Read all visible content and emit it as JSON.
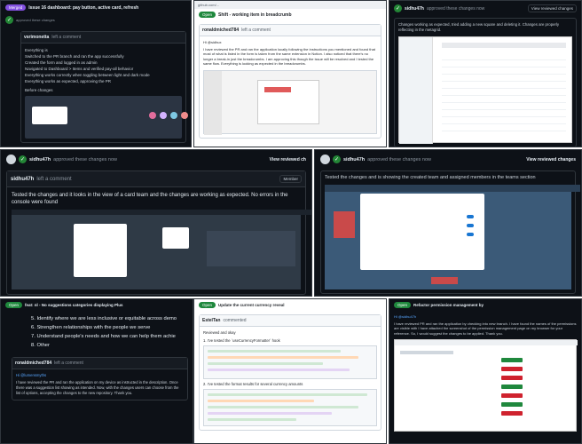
{
  "tile1": {
    "state_badge": "Merged",
    "title": "Issue 16 dashboard: pay button, active card, refresh",
    "commenter": "vsrimonetta",
    "comment_header": "left a comment",
    "lines": [
      "Everything is",
      "Switched to the PR branch and ran the app successfully",
      "Created the form and logged in as admin",
      "Navigated to Dashboard > Items and verified pay-all behavior",
      "Everything works correctly when toggling between light and dark mode",
      "Everything works as expected, approving the PR"
    ],
    "before_label": "Before changes"
  },
  "tile2": {
    "url": "github.com/...",
    "badge": "Open",
    "title": "Shift - working item in breadcrumb",
    "commenter": "ronaldmiched784",
    "comment_header": "left a comment",
    "greeting": "Hi @sidhux",
    "body": "I have reviewed the PR and ran the application locally following the instructions you mentioned and found that most of what is listed in the form is taken from the same extension in Notion. I also noticed that there's no longer a break-in just the breadcrumbs. I am approving this though the issue will be resolved and I tested the same flow. Everything is looking as expected in the breadcrumbs."
  },
  "tile3": {
    "author": "sidhu47h",
    "action": "approved these changes now",
    "view_label": "View reviewed changes",
    "body": "Changes working as expected, tried adding a new square and deleting it. Changes are properly reflecting in the metagrid."
  },
  "tile4": {
    "author": "sidhu47h",
    "action": "approved these changes now",
    "view_label": "View reviewed ch",
    "sub_author": "sidhu47h",
    "sub_action": "left a comment",
    "member_label": "Member",
    "body": "Tested the changes and it looks in the view of a card team and the changes are working as expected. No errors in the console were found"
  },
  "tile5": {
    "author": "sidhu47h",
    "action": "approved these changes now",
    "view_label": "View reviewed changes",
    "body": "Tested the changes and is showing the created team and assigned members in the teams section"
  },
  "tile6": {
    "badge": "Open",
    "title": "feat: nl - No suggestions categories displaying Plus",
    "list_items": [
      "5. Identify where we are less inclusive or equitable across demo",
      "6. Strengthen relationships with the people we serve",
      "7. Understand people's needs and how we can help them achie",
      "8. Other"
    ],
    "commenter": "ronaldmiched784",
    "comment_header": "left a comment",
    "mention": "Hi @lumensmyths",
    "body": "I have reviewed the PR and ran the application on my device as instructed in the description. Once there was a suggestion list showing as intended. Now, with the changes users can choose from the list of options, accepting the changes to the new repository. Thank you."
  },
  "tile7": {
    "badge": "Open",
    "title": "Update the current currency reveal",
    "commenter": "EstelTan",
    "comment_header": "commented",
    "intro": "Reviewed and okay",
    "step1": "1. I've tested the `useCurrencyFormatter` hook",
    "step2": "2. I've tested the format results for several currency amounts"
  },
  "tile8": {
    "badge": "Open",
    "title": "Refactor permission management by",
    "greeting": "Hi @sidhu47h",
    "body": "I have reviewed PR and ran the application by checking into new branch. I have found the names of the permissions are visible with I have attached the screenshot of the permission management page on my browser for your reference. So, I would suggest the changes to be applied. Thank you."
  }
}
